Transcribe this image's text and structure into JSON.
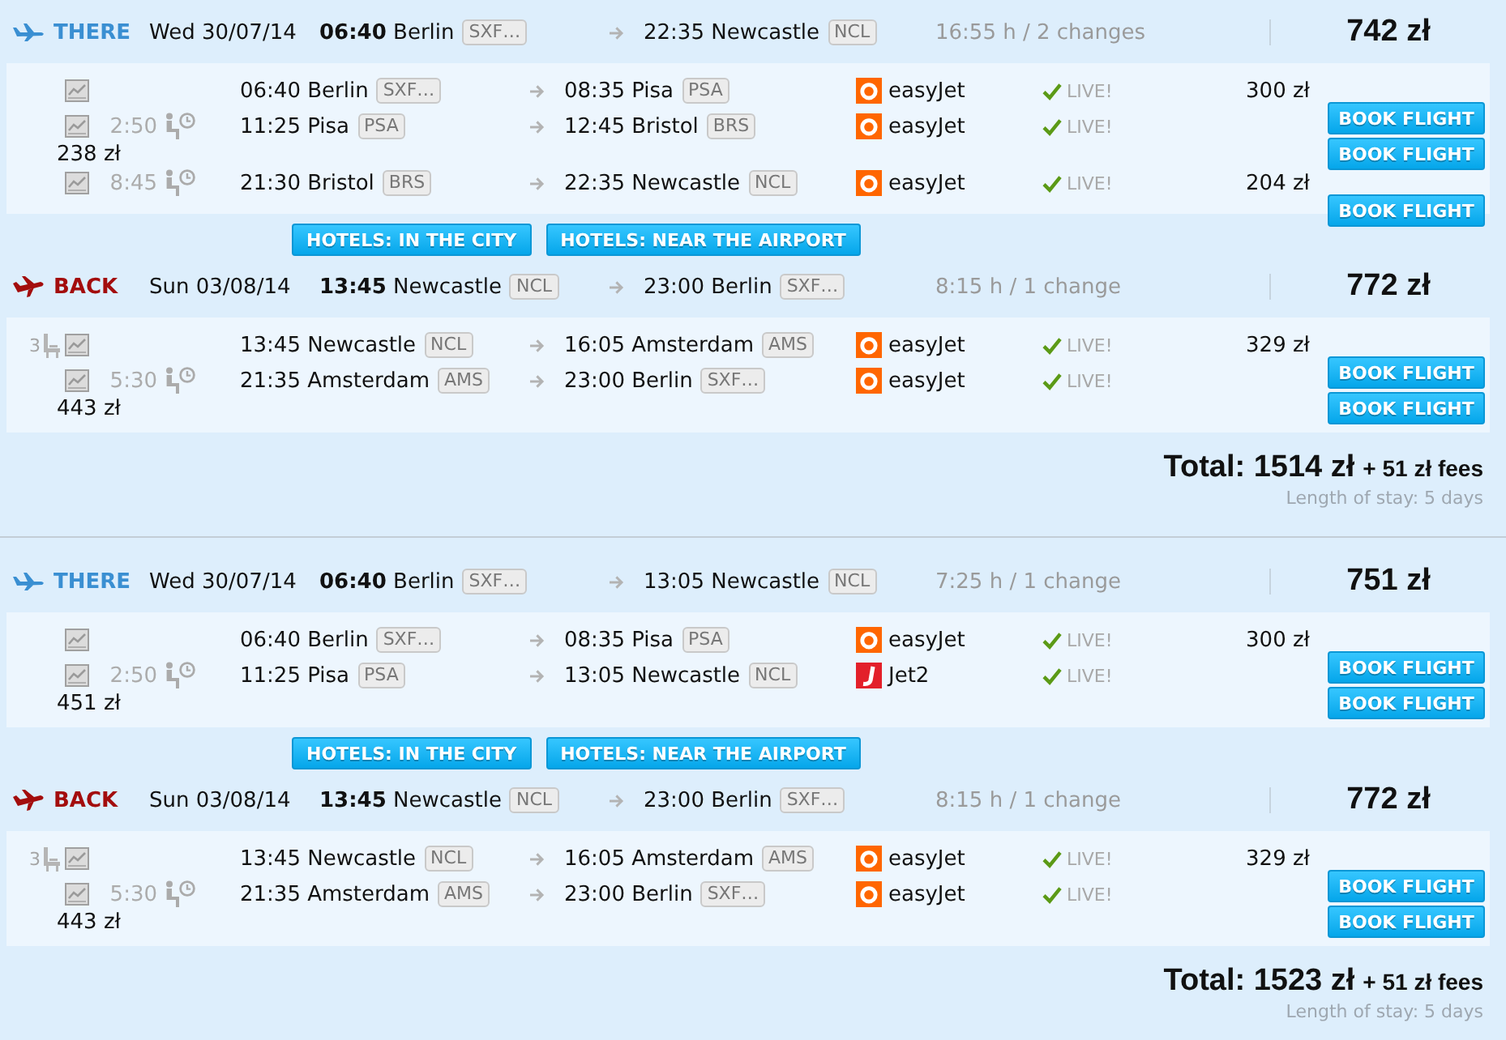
{
  "itineraries": [
    {
      "legs": [
        {
          "kind": "outbound",
          "label": "THERE",
          "date": "Wed 30/07/14",
          "departure": "**06:40** Berlin",
          "departure_code": "SXF…",
          "arrival": "22:35 Newcastle",
          "arrival_code": "NCL",
          "duration": "16:55 h / 2 changes",
          "price": "742 zł",
          "segments": [
            {
              "departure": "06:40 Berlin",
              "departure_code": "SXF…",
              "arrival": "08:35 Pisa",
              "arrival_code": "PSA",
              "airline": {
                "name": "easyJet",
                "kind": "round",
                "color": "#ff6600"
              },
              "confirmed": true,
              "status": "LIVE!",
              "price": "300 zł",
              "price_wrapped": false,
              "book": "BOOK FLIGHT"
            },
            {
              "layover": "2:50",
              "departure": "11:25 Pisa",
              "departure_code": "PSA",
              "arrival": "12:45 Bristol",
              "arrival_code": "BRS",
              "airline": {
                "name": "easyJet",
                "kind": "round",
                "color": "#ff6600"
              },
              "confirmed": true,
              "status": "LIVE!",
              "price": "238 zł",
              "price_wrapped": true,
              "book": "BOOK FLIGHT"
            },
            {
              "layover": "8:45",
              "departure": "21:30 Bristol",
              "departure_code": "BRS",
              "arrival": "22:35 Newcastle",
              "arrival_code": "NCL",
              "airline": {
                "name": "easyJet",
                "kind": "round",
                "color": "#ff6600"
              },
              "confirmed": true,
              "status": "LIVE!",
              "price": "204 zł",
              "price_wrapped": false,
              "book": "BOOK FLIGHT"
            }
          ],
          "hotel_links": [
            "HOTELS: IN THE CITY",
            "HOTELS: NEAR THE AIRPORT"
          ]
        },
        {
          "kind": "return",
          "label": "BACK",
          "date": "Sun 03/08/14",
          "departure": "**13:45** Newcastle",
          "departure_code": "NCL",
          "arrival": "23:00 Berlin",
          "arrival_code": "SXF…",
          "duration": "8:15 h / 1 change",
          "price": "772 zł",
          "segments": [
            {
              "seats_left": "3",
              "departure": "13:45 Newcastle",
              "departure_code": "NCL",
              "arrival": "16:05 Amsterdam",
              "arrival_code": "AMS",
              "airline": {
                "name": "easyJet",
                "kind": "round",
                "color": "#ff6600"
              },
              "confirmed": true,
              "status": "LIVE!",
              "price": "329 zł",
              "price_wrapped": false,
              "book": "BOOK FLIGHT"
            },
            {
              "layover": "5:30",
              "departure": "21:35 Amsterdam",
              "departure_code": "AMS",
              "arrival": "23:00 Berlin",
              "arrival_code": "SXF…",
              "airline": {
                "name": "easyJet",
                "kind": "round",
                "color": "#ff6600"
              },
              "confirmed": true,
              "status": "LIVE!",
              "price": "443 zł",
              "price_wrapped": true,
              "book": "BOOK FLIGHT"
            }
          ]
        }
      ],
      "total": "Total: 1514 zł",
      "fees": "+ 51 zł fees",
      "stay": "Length of stay: 5 days"
    },
    {
      "legs": [
        {
          "kind": "outbound",
          "label": "THERE",
          "date": "Wed 30/07/14",
          "departure": "**06:40** Berlin",
          "departure_code": "SXF…",
          "arrival": "13:05 Newcastle",
          "arrival_code": "NCL",
          "duration": "7:25 h / 1 change",
          "price": "751 zł",
          "segments": [
            {
              "departure": "06:40 Berlin",
              "departure_code": "SXF…",
              "arrival": "08:35 Pisa",
              "arrival_code": "PSA",
              "airline": {
                "name": "easyJet",
                "kind": "round",
                "color": "#ff6600"
              },
              "confirmed": true,
              "status": "LIVE!",
              "price": "300 zł",
              "price_wrapped": false,
              "book": "BOOK FLIGHT"
            },
            {
              "layover": "2:50",
              "departure": "11:25 Pisa",
              "departure_code": "PSA",
              "arrival": "13:05 Newcastle",
              "arrival_code": "NCL",
              "airline": {
                "name": "Jet2",
                "kind": "hook",
                "color": "#e3202a"
              },
              "confirmed": true,
              "status": "LIVE!",
              "price": "451 zł",
              "price_wrapped": true,
              "book": "BOOK FLIGHT"
            }
          ],
          "hotel_links": [
            "HOTELS: IN THE CITY",
            "HOTELS: NEAR THE AIRPORT"
          ]
        },
        {
          "kind": "return",
          "label": "BACK",
          "date": "Sun 03/08/14",
          "departure": "**13:45** Newcastle",
          "departure_code": "NCL",
          "arrival": "23:00 Berlin",
          "arrival_code": "SXF…",
          "duration": "8:15 h / 1 change",
          "price": "772 zł",
          "segments": [
            {
              "seats_left": "3",
              "departure": "13:45 Newcastle",
              "departure_code": "NCL",
              "arrival": "16:05 Amsterdam",
              "arrival_code": "AMS",
              "airline": {
                "name": "easyJet",
                "kind": "round",
                "color": "#ff6600"
              },
              "confirmed": true,
              "status": "LIVE!",
              "price": "329 zł",
              "price_wrapped": false,
              "book": "BOOK FLIGHT"
            },
            {
              "layover": "5:30",
              "departure": "21:35 Amsterdam",
              "departure_code": "AMS",
              "arrival": "23:00 Berlin",
              "arrival_code": "SXF…",
              "airline": {
                "name": "easyJet",
                "kind": "round",
                "color": "#ff6600"
              },
              "confirmed": true,
              "status": "LIVE!",
              "price": "443 zł",
              "price_wrapped": true,
              "book": "BOOK FLIGHT"
            }
          ]
        }
      ],
      "total": "Total: 1523 zł",
      "fees": "+ 51 zł fees",
      "stay": "Length of stay: 5 days"
    }
  ]
}
